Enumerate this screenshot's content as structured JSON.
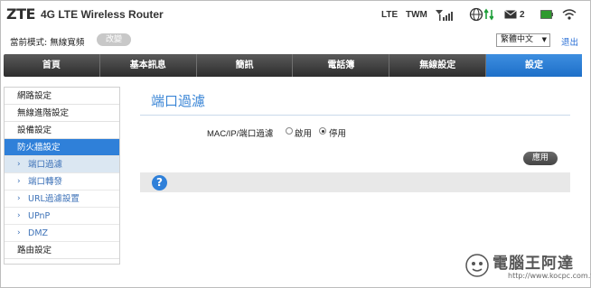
{
  "header": {
    "logo": "ZTE",
    "title": "4G LTE Wireless Router",
    "network_type": "LTE",
    "carrier": "TWM",
    "sms_count": "2"
  },
  "topbar": {
    "mode_label": "當前模式: 無線寬頻",
    "mode_button": "改變",
    "language": "繁體中文",
    "logout": "退出"
  },
  "nav": {
    "items": [
      {
        "label": "首頁"
      },
      {
        "label": "基本訊息"
      },
      {
        "label": "簡訊"
      },
      {
        "label": "電話簿"
      },
      {
        "label": "無線設定"
      },
      {
        "label": "設定"
      }
    ]
  },
  "sidebar": {
    "items": [
      {
        "label": "網路設定"
      },
      {
        "label": "無線進階設定"
      },
      {
        "label": "設備設定"
      },
      {
        "label": "防火牆設定"
      },
      {
        "label": "端口過濾"
      },
      {
        "label": "端口轉發"
      },
      {
        "label": "URL過濾設置"
      },
      {
        "label": "UPnP"
      },
      {
        "label": "DMZ"
      },
      {
        "label": "路由設定"
      }
    ]
  },
  "main": {
    "title": "端口過濾",
    "field_label": "MAC/IP/端口過濾",
    "option_enable": "啟用",
    "option_disable": "停用",
    "selected": "停用",
    "apply": "應用",
    "help": "?"
  },
  "watermark": {
    "text": "電腦王阿達",
    "url": "http://www.kocpc.com.tw"
  },
  "colors": {
    "accent": "#2f80d9",
    "title": "#3b86d6",
    "nav_dark": "#3a3a3a"
  }
}
